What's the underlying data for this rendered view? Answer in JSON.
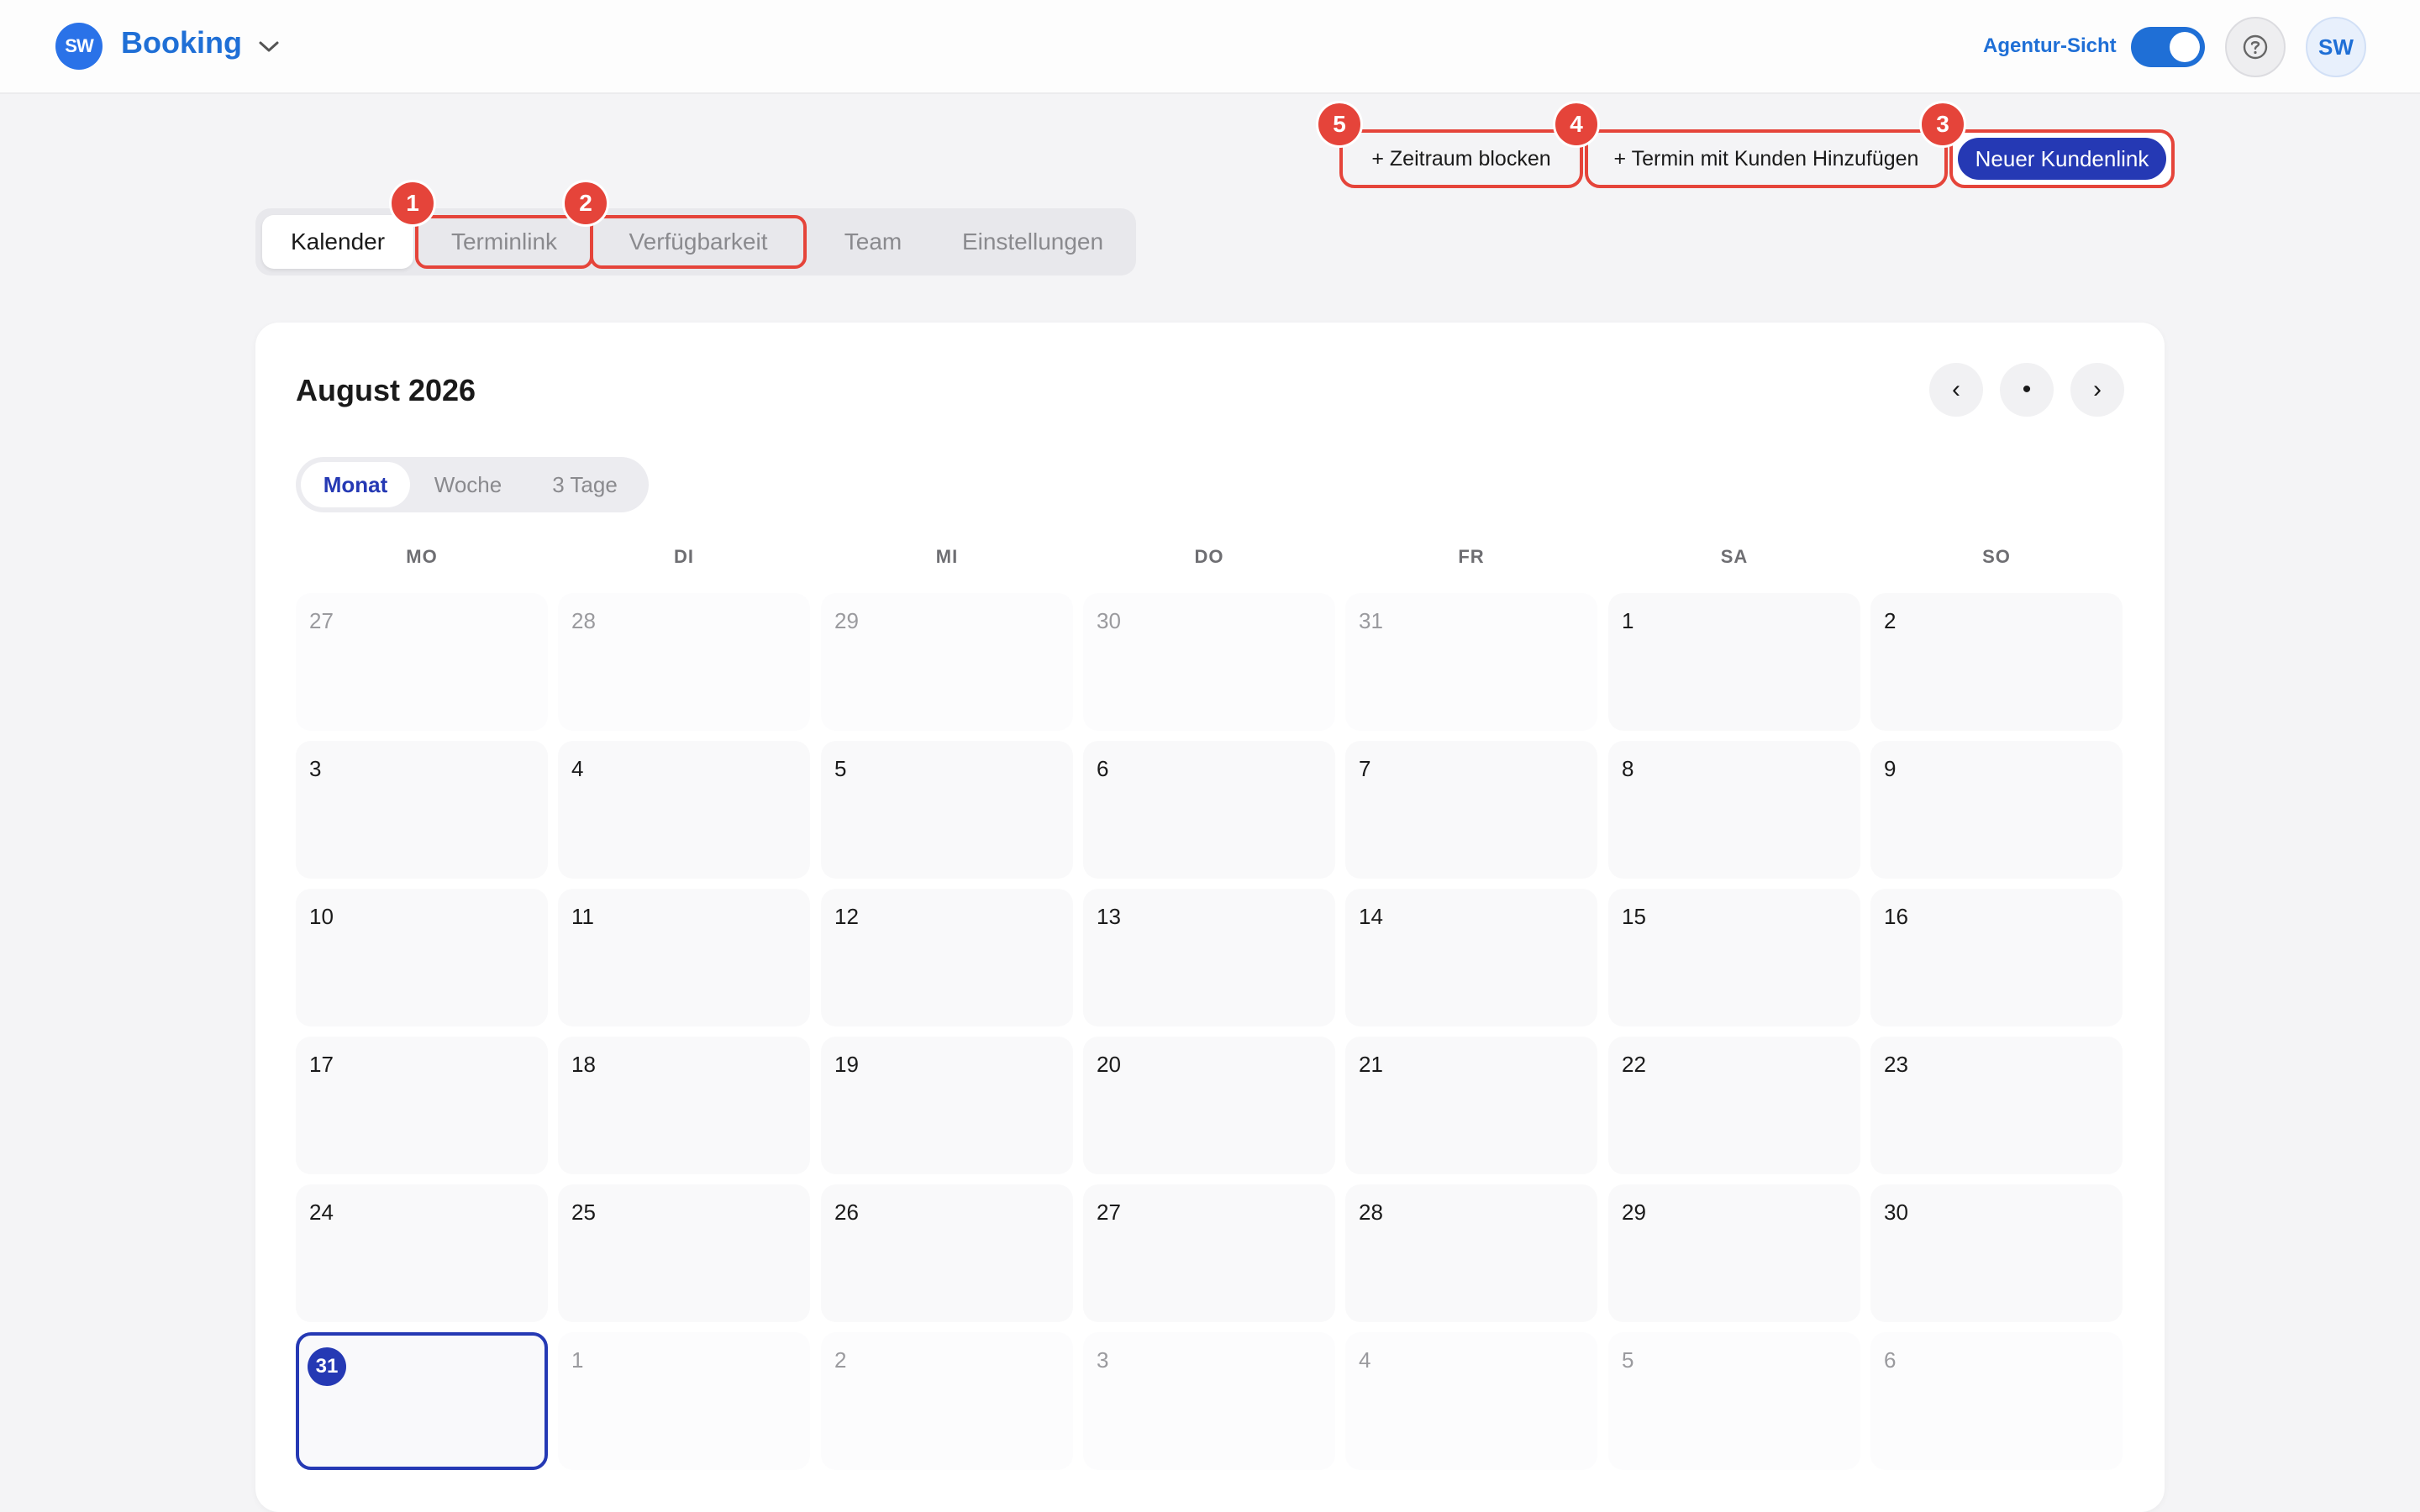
{
  "header": {
    "logo_text": "SW",
    "title": "Booking",
    "agency_label": "Agentur-Sicht",
    "avatar": "SW",
    "help_icon": "question-circle-icon",
    "toggle_on": true
  },
  "actions": {
    "block": "+ Zeitraum blocken",
    "add": "+ Termin mit Kunden Hinzufügen",
    "new_link": "Neuer Kundenlink"
  },
  "badges": [
    "1",
    "2",
    "3",
    "4",
    "5"
  ],
  "tabs": [
    "Kalender",
    "Terminlink",
    "Verfügbarkeit",
    "Team",
    "Einstellungen"
  ],
  "calendar": {
    "month_title": "August 2026",
    "nav": {
      "prev": "‹",
      "today": "•",
      "next": "›"
    },
    "views": [
      "Monat",
      "Woche",
      "3 Tage"
    ],
    "weekdays": [
      "MO",
      "DI",
      "MI",
      "DO",
      "FR",
      "SA",
      "SO"
    ],
    "weeks": [
      [
        "27",
        "28",
        "29",
        "30",
        "31",
        "1",
        "2"
      ],
      [
        "3",
        "4",
        "5",
        "6",
        "7",
        "8",
        "9"
      ],
      [
        "10",
        "11",
        "12",
        "13",
        "14",
        "15",
        "16"
      ],
      [
        "17",
        "18",
        "19",
        "20",
        "21",
        "22",
        "23"
      ],
      [
        "24",
        "25",
        "26",
        "27",
        "28",
        "29",
        "30"
      ],
      [
        "31",
        "1",
        "2",
        "3",
        "4",
        "5",
        "6"
      ]
    ]
  },
  "colors": {
    "accent": "#1f6fd6",
    "primary_button": "#2539b4",
    "highlight": "#e5443a"
  }
}
